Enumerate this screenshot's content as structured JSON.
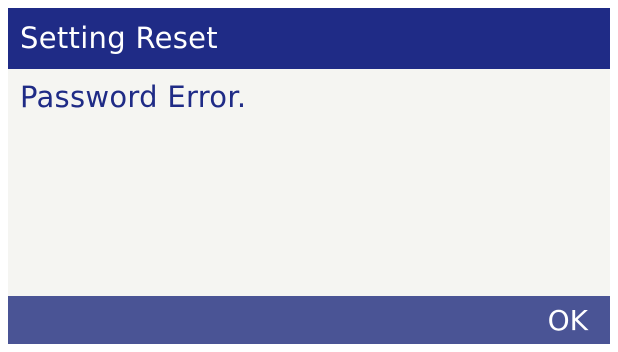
{
  "title_bar": {
    "title": "Setting Reset"
  },
  "content": {
    "message": "Password Error."
  },
  "softkeys": {
    "ok_label": "OK"
  },
  "colors": {
    "title_bar_bg": "#1f2b86",
    "content_bg": "#f5f5f2",
    "message_text": "#1f2b86",
    "softkey_bar_bg": "#4a5495",
    "softkey_text": "#ffffff"
  }
}
